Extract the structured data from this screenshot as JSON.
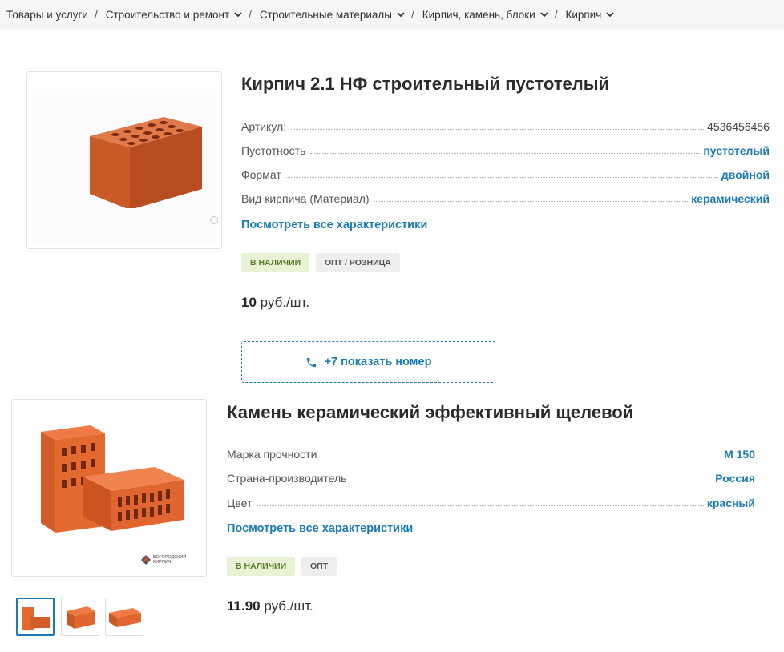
{
  "breadcrumb": {
    "items": [
      {
        "label": "Товары и услуги",
        "dropdown": false
      },
      {
        "label": "Строительство и ремонт",
        "dropdown": true
      },
      {
        "label": "Строительные материалы",
        "dropdown": true
      },
      {
        "label": "Кирпич, камень, блоки",
        "dropdown": true
      },
      {
        "label": "Кирпич",
        "dropdown": true
      }
    ],
    "separator": "/"
  },
  "products": [
    {
      "title": "Кирпич 2.1 НФ строительный пустотелый",
      "properties": [
        {
          "label": "Артикул:",
          "value": "4536456456",
          "link": false
        },
        {
          "label": "Пустотность",
          "value": "пустотелый",
          "link": true
        },
        {
          "label": "Формат",
          "value": "двойной",
          "link": true
        },
        {
          "label": "Вид кирпича (Материал)",
          "value": "керамический",
          "link": true
        }
      ],
      "all_chars_label": "Посмотреть все характеристики",
      "badges": [
        "В НАЛИЧИИ",
        "ОПТ / РОЗНИЦА"
      ],
      "price": {
        "amount": "10",
        "unit": "руб./шт."
      },
      "phone_label": "+7 показать номер"
    },
    {
      "title": "Камень керамический эффективный щелевой",
      "properties": [
        {
          "label": "Марка прочности",
          "value": "М 150",
          "link": true
        },
        {
          "label": "Страна-производитель",
          "value": "Россия",
          "link": true
        },
        {
          "label": "Цвет",
          "value": "красный",
          "link": true
        }
      ],
      "all_chars_label": "Посмотреть все характеристики",
      "badges": [
        "В НАЛИЧИИ",
        "ОПТ"
      ],
      "price": {
        "amount": "11.90",
        "unit": "руб./шт."
      },
      "brand_logo_text": "БОГОРОДСКИЙ КИРПИЧ",
      "thumbnail_count": 3
    }
  ],
  "colors": {
    "link": "#1d7bb3",
    "stock_badge_bg": "#e7f3d4",
    "brick": "#d2541e"
  }
}
